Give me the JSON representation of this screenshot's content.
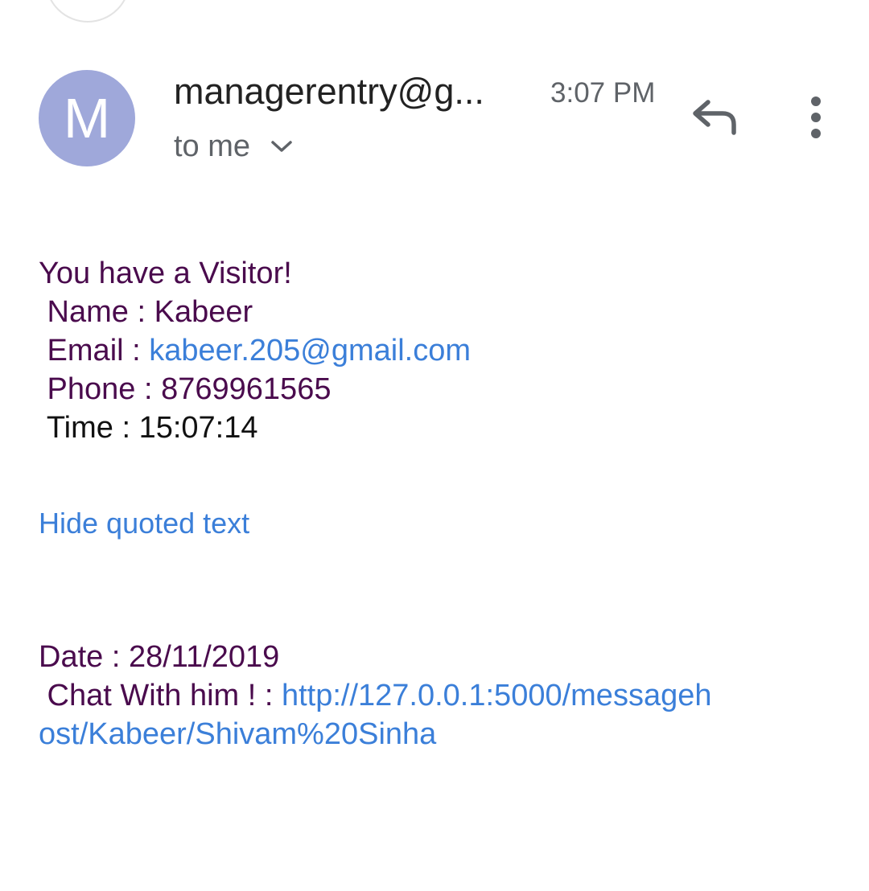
{
  "header": {
    "avatar_letter": "M",
    "sender": "managerentry@g...",
    "time": "3:07 PM",
    "recipient": "to me",
    "icons": {
      "reply": "reply-icon",
      "more": "more-vert-icon",
      "expand": "chevron-down-icon"
    },
    "avatar_color": "#9fa8da"
  },
  "body": {
    "greeting": "You have a Visitor!",
    "name_label": " Name : ",
    "name_value": "Kabeer",
    "email_label": " Email : ",
    "email_value": "kabeer.205@gmail.com",
    "phone_label": " Phone : ",
    "phone_value": "8769961565",
    "time_label": " Time : ",
    "time_value": "15:07:14",
    "hide_quoted": "Hide quoted text",
    "date_label": "Date : ",
    "date_value": "28/11/2019",
    "chat_label": " Chat With him ! : ",
    "chat_url_part1": "http://127.0.0.1:5000/messageh",
    "chat_url_part2": "ost/Kabeer/Shivam%20Sinha"
  },
  "colors": {
    "text_purple": "#4a0b4d",
    "link_blue": "#3b7fd9",
    "muted_gray": "#5f6368"
  }
}
